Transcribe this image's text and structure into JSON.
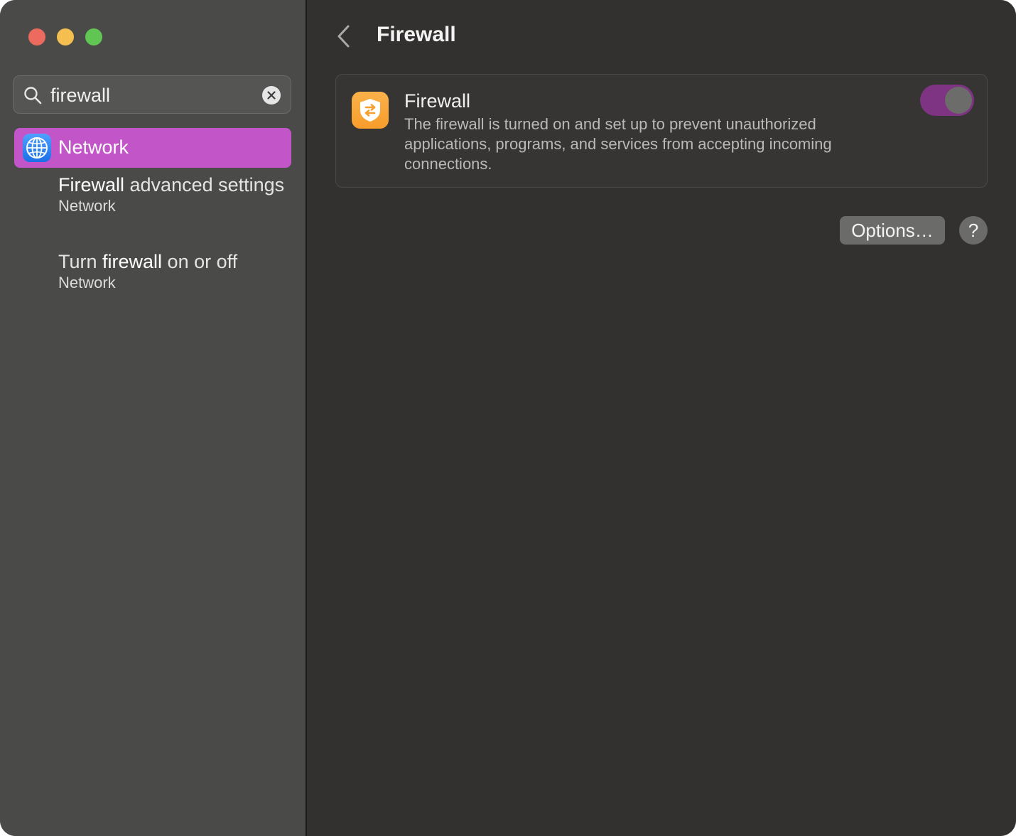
{
  "window": {
    "traffic_lights": [
      "close",
      "minimize",
      "zoom"
    ]
  },
  "sidebar": {
    "search": {
      "value": "firewall",
      "icon": "search-icon",
      "clear_icon": "clear-icon"
    },
    "selected_item": {
      "label": "Network",
      "icon": "globe-icon",
      "highlight_color": "#c256c9"
    },
    "results": [
      {
        "title_pre": "",
        "title_match": "Firewall",
        "title_post": " advanced settings",
        "subtitle": "Network"
      },
      {
        "title_pre": "Turn ",
        "title_match": "firewall",
        "title_post": " on or off",
        "subtitle": "Network"
      }
    ]
  },
  "main": {
    "title": "Firewall",
    "back_icon": "chevron-left-icon",
    "card": {
      "icon": "firewall-shield-icon",
      "title": "Firewall",
      "description": "The firewall is turned on and set up to prevent unauthorized applications, programs, and services from accepting incoming connections.",
      "toggle_on": true,
      "toggle_color": "#7e3482"
    },
    "options_label": "Options…",
    "help_label": "?"
  }
}
